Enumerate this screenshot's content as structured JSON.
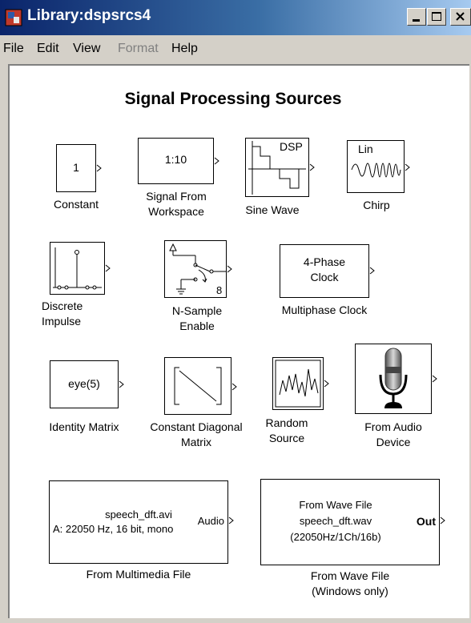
{
  "window": {
    "title": "Library:dspsrcs4",
    "controls": {
      "minimize": "minimize",
      "maximize": "maximize",
      "close": "close"
    }
  },
  "menu": {
    "file": "File",
    "edit": "Edit",
    "view": "View",
    "format": "Format",
    "help": "Help"
  },
  "library": {
    "title": "Signal Processing Sources"
  },
  "blocks": {
    "constant": {
      "icon_text": "1",
      "label": "Constant"
    },
    "signal_from_workspace": {
      "icon_text": "1:10",
      "label": "Signal From\nWorkspace"
    },
    "sine_wave": {
      "icon_text": "DSP",
      "label": "Sine Wave"
    },
    "chirp": {
      "icon_text": "Lin",
      "label": "Chirp"
    },
    "discrete_impulse": {
      "label": "Discrete\nImpulse"
    },
    "n_sample_enable": {
      "icon_text": "8",
      "label": "N-Sample\nEnable"
    },
    "multiphase_clock": {
      "icon_text": "4-Phase\nClock",
      "label": "Multiphase Clock"
    },
    "identity_matrix": {
      "icon_text": "eye(5)",
      "label": "Identity Matrix"
    },
    "constant_diagonal_matrix": {
      "label": "Constant Diagonal\nMatrix"
    },
    "random_source": {
      "label": "Random\nSource"
    },
    "from_audio_device": {
      "label": "From Audio\nDevice"
    },
    "from_multimedia_file": {
      "icon_line1": "speech_dft.avi",
      "icon_line2": "A: 22050 Hz, 16 bit, mono",
      "port_text": "Audio",
      "label": "From Multimedia File"
    },
    "from_wave_file": {
      "icon_line1": "From Wave File",
      "icon_line2": "speech_dft.wav",
      "icon_line3": "(22050Hz/1Ch/16b)",
      "port_text": "Out",
      "label": "From Wave File\n(Windows only)"
    }
  }
}
